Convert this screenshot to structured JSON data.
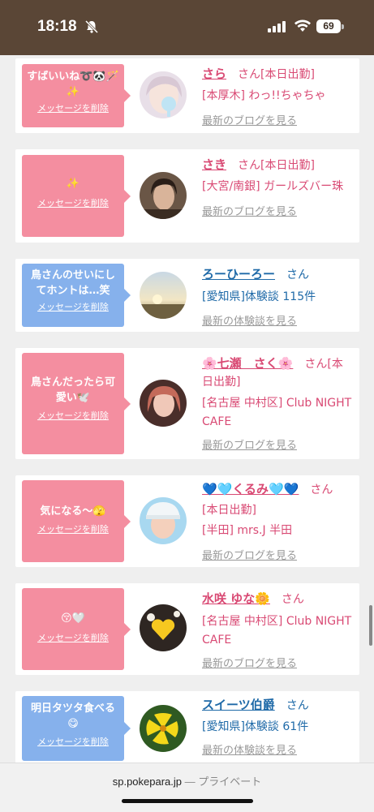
{
  "status": {
    "time": "18:18",
    "battery": "69"
  },
  "browser": {
    "domain": "sp.pokepara.jp",
    "mode": "— プライベート"
  },
  "common": {
    "san": "さん",
    "delete": "メッセージを削除"
  },
  "cards": [
    {
      "msg": "すばいいね➰🐼🪄✨",
      "name": "さら",
      "line1": "[本日出勤]",
      "line2": "[本厚木] わっ!!ちゃちゃ",
      "link": "最新のブログを見る"
    },
    {
      "msg": "✨",
      "name": "さき",
      "line1": "[本日出勤]",
      "line2": "[大宮/南銀] ガールズバー珠",
      "link": "最新のブログを見る"
    },
    {
      "msg": "鳥さんのせいにしてホントは…笑",
      "name": "ろーひーろー",
      "line1": "[愛知県]体験談 115件",
      "link": "最新の体験談を見る"
    },
    {
      "msg": "鳥さんだったら可愛い🕊️",
      "name": "🌸七瀬　さく🌸",
      "line1": "[本日出勤]",
      "line2": "[名古屋 中村区] Club NIGHT CAFE",
      "link": "最新のブログを見る"
    },
    {
      "msg": "気になる〜🫣",
      "name": "💙🩵くるみ🩵💙",
      "line1": "[本日出勤]",
      "line2": "[半田] mrs.J 半田",
      "link": "最新のブログを見る"
    },
    {
      "msg": "😚🤍",
      "name": "水咲 ゆな🌼",
      "line2": "[名古屋 中村区] Club NIGHT CAFE",
      "link": "最新のブログを見る"
    },
    {
      "msg": "明日タツタ食べる😋",
      "name": "スイーツ伯爵",
      "line1": "[愛知県]体験談 61件",
      "link": "最新の体験談を見る"
    }
  ]
}
